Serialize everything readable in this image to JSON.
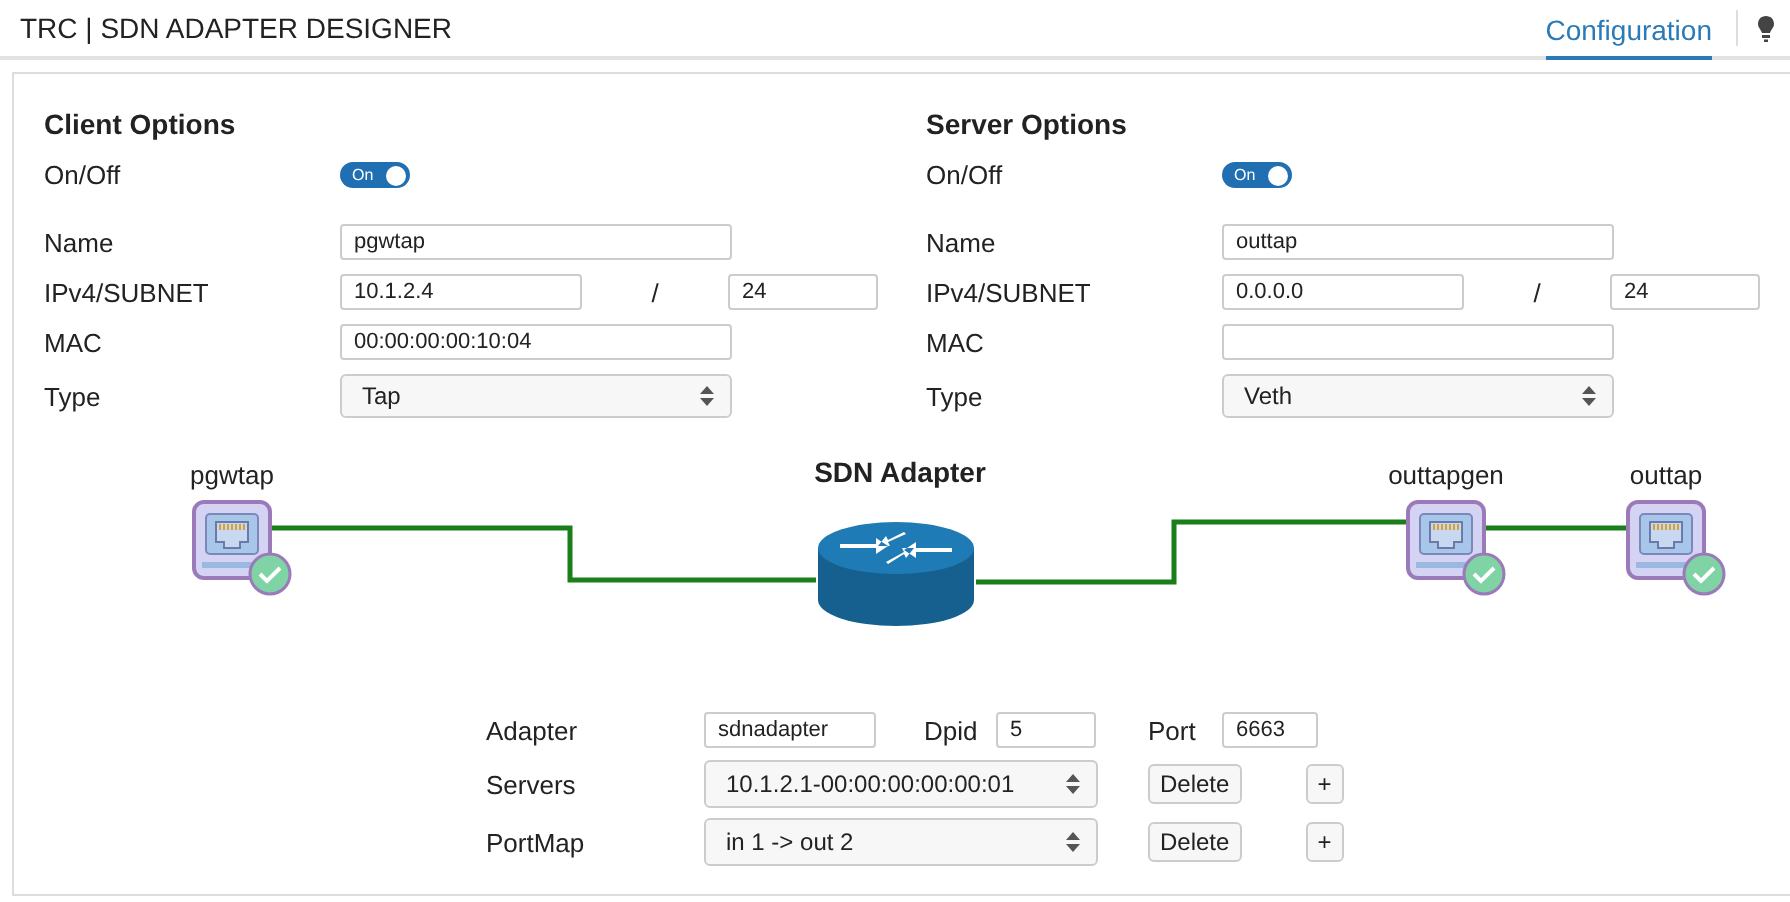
{
  "header": {
    "title": "TRC | SDN ADAPTER DESIGNER",
    "tabs": [
      {
        "label": "Configuration",
        "selected": true
      }
    ]
  },
  "panels": [
    {
      "title": "Client Options",
      "fields": [
        {
          "kind": "toggle",
          "label": "On/Off",
          "text": "On",
          "on": true
        },
        {
          "kind": "text",
          "label": "Name",
          "value": "pgwtap"
        },
        {
          "kind": "ip",
          "label": "IPv4/SUBNET",
          "value": "10.1.2.4",
          "separator": "/",
          "subnet": "24"
        },
        {
          "kind": "text",
          "label": "MAC",
          "value": "00:00:00:00:10:04"
        },
        {
          "kind": "select",
          "label": "Type",
          "value": "Tap"
        }
      ]
    },
    {
      "title": "Server Options",
      "fields": [
        {
          "kind": "toggle",
          "label": "On/Off",
          "text": "On",
          "on": true
        },
        {
          "kind": "text",
          "label": "Name",
          "value": "outtap"
        },
        {
          "kind": "ip",
          "label": "IPv4/SUBNET",
          "value": "0.0.0.0",
          "separator": "/",
          "subnet": "24"
        },
        {
          "kind": "text",
          "label": "MAC"
        },
        {
          "kind": "select",
          "label": "Type",
          "value": "Veth"
        }
      ]
    }
  ],
  "diagram": {
    "title": "SDN Adapter",
    "nodes": [
      {
        "label": "pgwtap"
      },
      {
        "label": "outtapgen"
      },
      {
        "label": "outtap"
      }
    ]
  },
  "adapter": {
    "rows": [
      {
        "kind": "fields",
        "items": [
          {
            "label": "Adapter",
            "value": "sdnadapter"
          },
          {
            "label": "Dpid",
            "value": "5"
          },
          {
            "label": "Port",
            "value": "6663"
          }
        ]
      },
      {
        "kind": "list",
        "label": "Servers",
        "value": "10.1.2.1-00:00:00:00:00:01",
        "buttons": [
          "Delete",
          "+"
        ]
      },
      {
        "kind": "list",
        "label": "PortMap",
        "value": "in 1 -> out 2",
        "buttons": [
          "Delete",
          "+"
        ]
      }
    ]
  }
}
